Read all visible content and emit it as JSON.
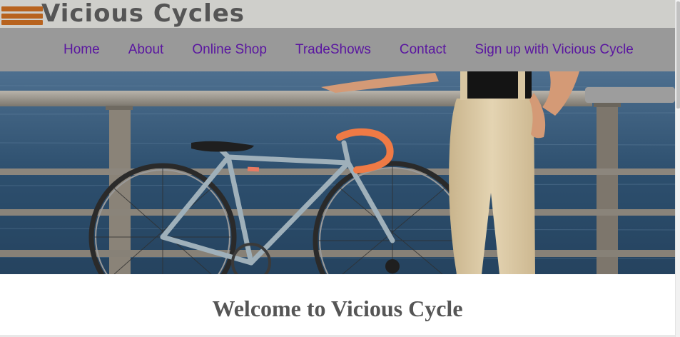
{
  "header": {
    "logo_text": "Vicious  Cycles"
  },
  "nav": {
    "items": [
      {
        "label": "Home"
      },
      {
        "label": "About"
      },
      {
        "label": "Online Shop"
      },
      {
        "label": "TradeShows"
      },
      {
        "label": "Contact"
      },
      {
        "label": "Sign up with Vicious Cycle"
      }
    ]
  },
  "main": {
    "heading": "Welcome to Vicious Cycle"
  },
  "colors": {
    "header_bg": "#cfcfcb",
    "nav_bg": "#999999",
    "nav_link": "#5a16a0",
    "logo_accent": "#b8631e",
    "heading": "#555555"
  },
  "icons": [
    "logo-stripes-icon"
  ]
}
